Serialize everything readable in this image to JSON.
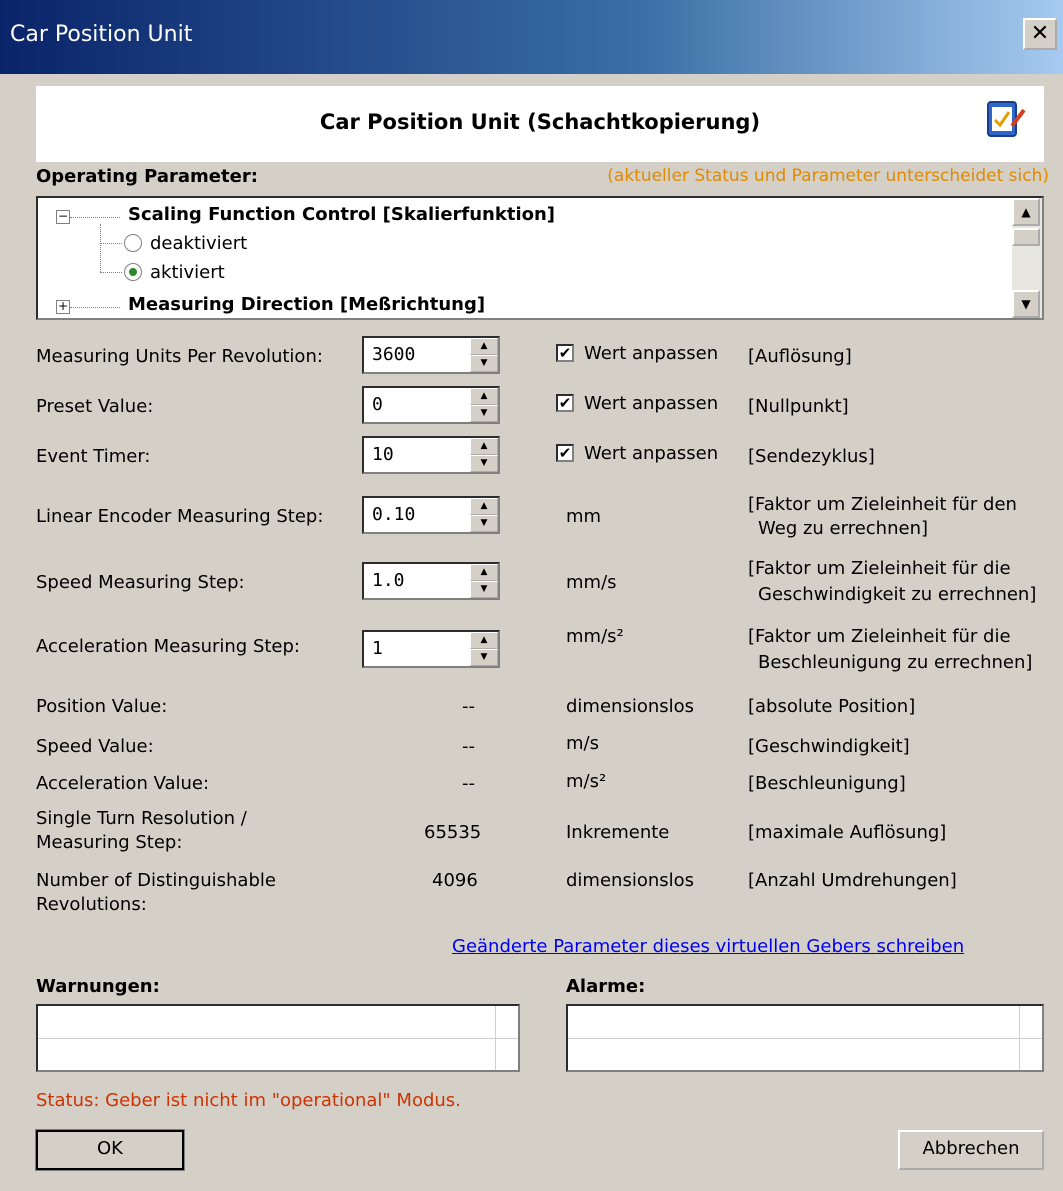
{
  "window": {
    "title": "Car Position Unit",
    "close_glyph": "✕"
  },
  "header": {
    "title": "Car Position Unit (Schachtkopierung)",
    "icon": "checklist-icon"
  },
  "operating": {
    "label": "Operating Parameter:",
    "note": "(aktueller Status und Parameter unterscheidet sich)",
    "note_color": "#e08a00"
  },
  "tree": {
    "group1": {
      "label": "Scaling Function Control [Skalierfunktion]",
      "expander": "−",
      "options": [
        {
          "label": "deaktiviert",
          "selected": false
        },
        {
          "label": "aktiviert",
          "selected": true
        }
      ]
    },
    "group2": {
      "label": "Measuring Direction [Meßrichtung]",
      "expander": "+"
    }
  },
  "params": [
    {
      "label": "Measuring Units Per Revolution:",
      "value": "3600",
      "check_label": "Wert anpassen",
      "checked": true,
      "desc": "[Auflösung]"
    },
    {
      "label": "Preset Value:",
      "value": "0",
      "check_label": "Wert anpassen",
      "checked": true,
      "desc": "[Nullpunkt]"
    },
    {
      "label": "Event Timer:",
      "value": "10",
      "check_label": "Wert anpassen",
      "checked": true,
      "desc": "[Sendezyklus]"
    },
    {
      "label": "Linear Encoder Measuring Step:",
      "value": "0.10",
      "unit": "mm",
      "desc1": "[Faktor um Zieleinheit für den",
      "desc2": "Weg zu errechnen]"
    },
    {
      "label": "Speed Measuring Step:",
      "value": "1.0",
      "unit": "mm/s",
      "desc1": "[Faktor um Zieleinheit für die",
      "desc2": "Geschwindigkeit zu errechnen]"
    },
    {
      "label": "Acceleration Measuring Step:",
      "value": "1",
      "unit": "mm/s²",
      "desc1": "[Faktor um Zieleinheit für die",
      "desc2": "Beschleunigung zu errechnen]"
    }
  ],
  "readouts": [
    {
      "label": "Position Value:",
      "value": "--",
      "unit": "dimensionslos",
      "desc": "[absolute Position]"
    },
    {
      "label": "Speed Value:",
      "value": "--",
      "unit": "m/s",
      "desc": "[Geschwindigkeit]"
    },
    {
      "label": "Acceleration Value:",
      "value": "--",
      "unit": "m/s²",
      "desc": "[Beschleunigung]"
    },
    {
      "label1": "Single Turn Resolution /",
      "label2": "Measuring Step:",
      "value": "65535",
      "unit": "Inkremente",
      "desc": "[maximale Auflösung]"
    },
    {
      "label1": "Number of Distinguishable",
      "label2": "Revolutions:",
      "value": "4096",
      "unit": "dimensionslos",
      "desc": "[Anzahl Umdrehungen]"
    }
  ],
  "write_link": "Geänderte Parameter dieses virtuellen Gebers schreiben",
  "warnings": {
    "label": "Warnungen:"
  },
  "alarms": {
    "label": "Alarme:"
  },
  "status": {
    "text": "Status: Geber ist nicht im \"operational\" Modus.",
    "color": "#cc3300"
  },
  "buttons": {
    "ok": "OK",
    "cancel": "Abbrechen"
  },
  "glyphs": {
    "check": "✔",
    "up": "▲",
    "down": "▼"
  }
}
